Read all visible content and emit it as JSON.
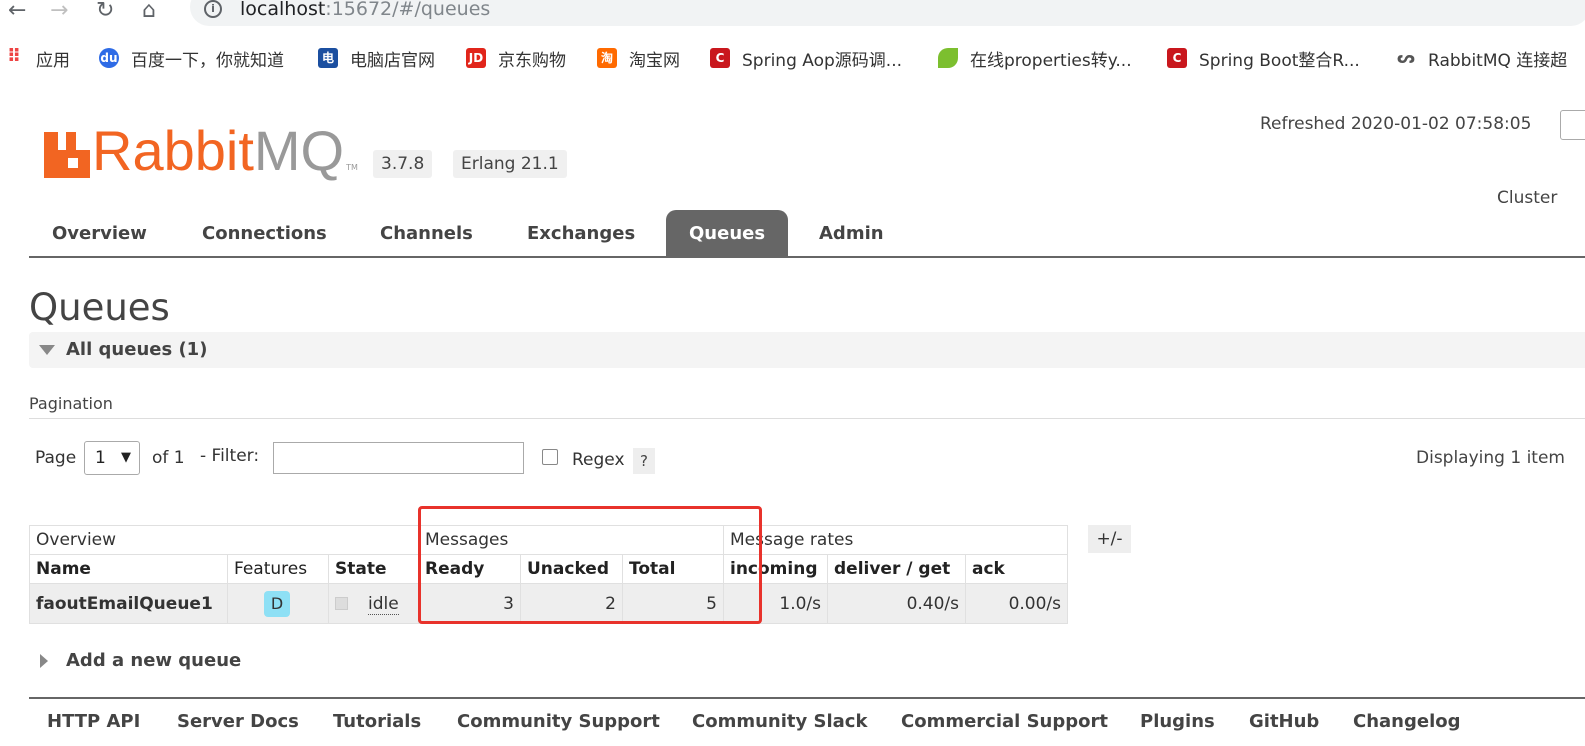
{
  "browser": {
    "url_host": "localhost",
    "url_rest": ":15672/#/queues",
    "bookmarks": [
      {
        "label": "应用",
        "icon": "apps-grid-icon"
      },
      {
        "label": "百度一下，你就知道",
        "icon": "baidu-paw-icon"
      },
      {
        "label": "电脑店官网",
        "icon": "diannaodian-icon"
      },
      {
        "label": "京东购物",
        "icon": "jd-icon"
      },
      {
        "label": "淘宝网",
        "icon": "taobao-icon"
      },
      {
        "label": "Spring Aop源码调...",
        "icon": "csdn-icon"
      },
      {
        "label": "在线properties转y...",
        "icon": "leaf-icon"
      },
      {
        "label": "Spring Boot整合R...",
        "icon": "csdn-icon"
      },
      {
        "label": "RabbitMQ 连接超",
        "icon": "rabbitmq-bookmark-icon"
      }
    ]
  },
  "header": {
    "logo_rabbit": "Rabbit",
    "logo_mq": "MQ",
    "logo_tm": "TM",
    "version": "3.7.8",
    "erlang": "Erlang 21.1",
    "refreshed": "Refreshed 2020-01-02 07:58:05",
    "cluster": "Cluster"
  },
  "tabs": [
    "Overview",
    "Connections",
    "Channels",
    "Exchanges",
    "Queues",
    "Admin"
  ],
  "active_tab": "Queues",
  "page": {
    "title": "Queues",
    "section_title": "All queues (1)",
    "pagination_label": "Pagination",
    "page_label": "Page",
    "page_value": "1",
    "of_label": "of 1",
    "filter_label": "- Filter:",
    "filter_value": "",
    "regex_label": "Regex",
    "help": "?",
    "displaying": "Displaying 1 item"
  },
  "table": {
    "groups": [
      "Overview",
      "Messages",
      "Message rates"
    ],
    "plusminus": "+/-",
    "columns": [
      "Name",
      "Features",
      "State",
      "Ready",
      "Unacked",
      "Total",
      "incoming",
      "deliver / get",
      "ack"
    ],
    "rows": [
      {
        "name": "faoutEmailQueue1",
        "feature": "D",
        "state": "idle",
        "ready": "3",
        "unacked": "2",
        "total": "5",
        "incoming": "1.0/s",
        "deliver_get": "0.40/s",
        "ack": "0.00/s"
      }
    ]
  },
  "add_queue": "Add a new queue",
  "footer": [
    "HTTP API",
    "Server Docs",
    "Tutorials",
    "Community Support",
    "Community Slack",
    "Commercial Support",
    "Plugins",
    "GitHub",
    "Changelog"
  ],
  "colors": {
    "brand": "#f26522",
    "highlight": "#e8322b",
    "tab_active": "#666666",
    "durable_badge": "#8ee0f5"
  }
}
